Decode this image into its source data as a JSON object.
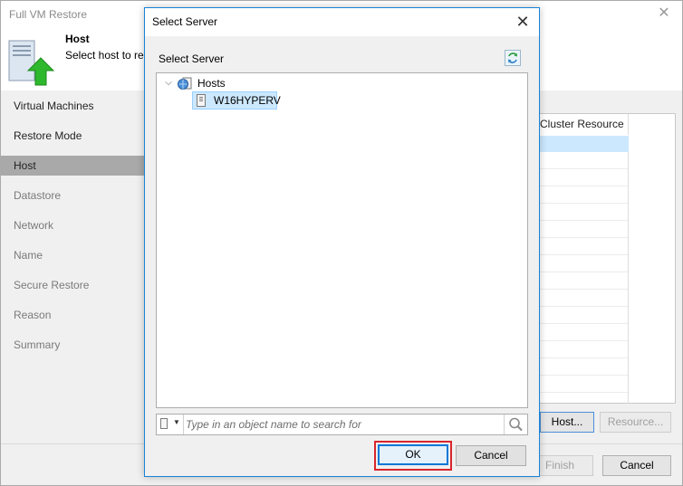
{
  "wizard": {
    "title": "Full VM Restore",
    "header_title": "Host",
    "header_subtitle": "Select host to res",
    "nav": [
      {
        "label": "Virtual Machines",
        "state": "done"
      },
      {
        "label": "Restore Mode",
        "state": "done"
      },
      {
        "label": "Host",
        "state": "active"
      },
      {
        "label": "Datastore",
        "state": "pending"
      },
      {
        "label": "Network",
        "state": "pending"
      },
      {
        "label": "Name",
        "state": "pending"
      },
      {
        "label": "Secure Restore",
        "state": "pending"
      },
      {
        "label": "Reason",
        "state": "pending"
      },
      {
        "label": "Summary",
        "state": "pending"
      }
    ],
    "grid_column_header": "Cluster Resource",
    "host_button": "Host...",
    "resource_button": "Resource...",
    "finish_button": "Finish",
    "cancel_button": "Cancel"
  },
  "dialog": {
    "title": "Select Server",
    "label": "Select Server",
    "tree": {
      "root": {
        "label": "Hosts",
        "expanded": true,
        "icon": "hosts-folder-icon"
      },
      "children": [
        {
          "label": "W16HYPERV",
          "selected": true,
          "icon": "server-icon"
        }
      ]
    },
    "search": {
      "placeholder": "Type in an object name to search for",
      "value": ""
    },
    "ok_button": "OK",
    "cancel_button": "Cancel"
  },
  "colors": {
    "accent": "#0078d7",
    "selection": "#cce8ff",
    "focus_outline": "#d9262c",
    "sidebar_active": "#a9a9a9",
    "arrow_green": "#2eb82e"
  }
}
